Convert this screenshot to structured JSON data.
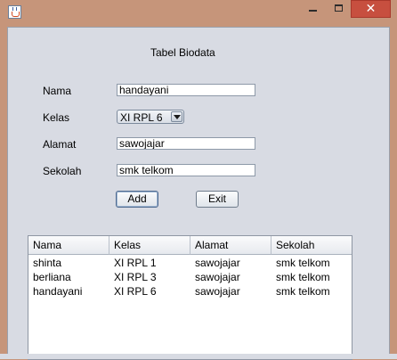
{
  "window": {
    "title": ""
  },
  "form": {
    "heading": "Tabel Biodata",
    "nama_label": "Nama",
    "nama_value": "handayani",
    "kelas_label": "Kelas",
    "kelas_value": "XI RPL 6",
    "alamat_label": "Alamat",
    "alamat_value": "sawojajar",
    "sekolah_label": "Sekolah",
    "sekolah_value": "smk telkom",
    "add_label": "Add",
    "exit_label": "Exit"
  },
  "table": {
    "columns": [
      "Nama",
      "Kelas",
      "Alamat",
      "Sekolah"
    ],
    "rows": [
      [
        "shinta",
        "XI RPL 1",
        "sawojajar",
        "smk telkom"
      ],
      [
        "berliana",
        "XI RPL 3",
        "sawojajar",
        "smk telkom"
      ],
      [
        "handayani",
        "XI RPL 6",
        "sawojajar",
        "smk telkom"
      ]
    ]
  },
  "colors": {
    "frame": "#c6957a",
    "close": "#c74f3f",
    "panel": "#d8dbe3"
  }
}
